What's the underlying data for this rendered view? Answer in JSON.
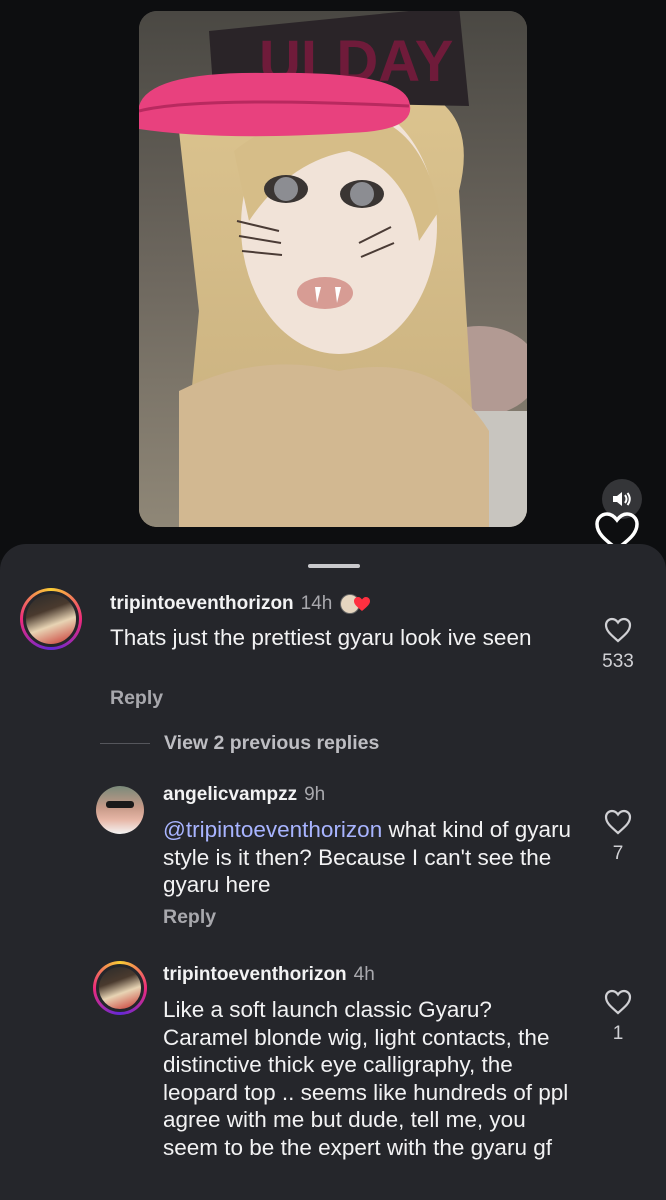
{
  "comments": [
    {
      "username": "tripintoeventhorizon",
      "time": "14h",
      "text": "Thats just the prettiest gyaru look ive seen",
      "reply_label": "Reply",
      "likes": "533"
    }
  ],
  "view_replies": "View 2 previous replies",
  "replies": [
    {
      "username": "angelicvampzz",
      "time": "9h",
      "mention": "@tripintoeventhorizon",
      "text": " what kind of gyaru style is it then? Because I can't see the gyaru here",
      "reply_label": "Reply",
      "likes": "7"
    },
    {
      "username": "tripintoeventhorizon",
      "time": "4h",
      "text": "Like a soft launch classic Gyaru? Caramel blonde wig, light contacts, the distinctive thick eye calligraphy, the leopard top .. seems like hundreds of ppl agree with me but dude, tell me,  you seem to be the expert with the gyaru gf",
      "likes": "1"
    }
  ],
  "icons": {
    "mute": "speaker-icon",
    "like": "heart-outline-icon",
    "liked_by_author": "heart-filled-icon"
  },
  "colors": {
    "sheet_bg": "#25262b",
    "mention": "#a8b4ff",
    "heart_red": "#ff3040",
    "hat_pink": "#e8417e"
  }
}
